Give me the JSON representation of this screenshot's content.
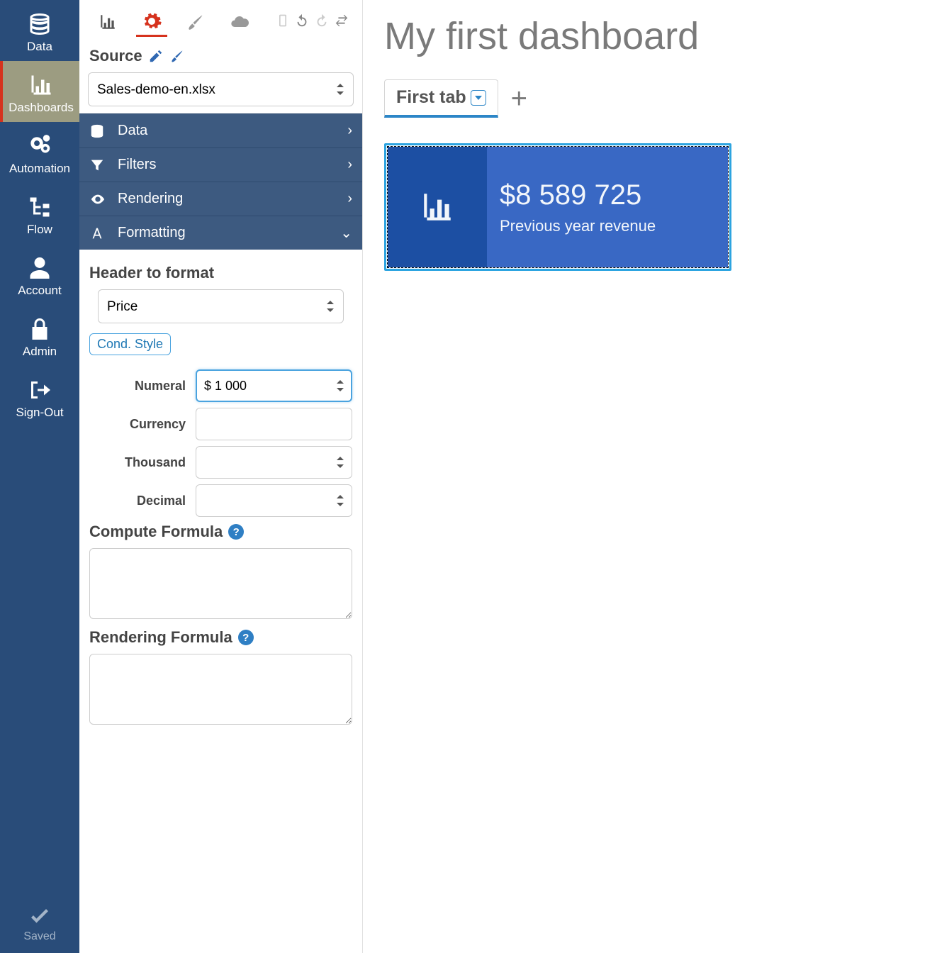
{
  "sidebar": {
    "items": [
      {
        "label": "Data"
      },
      {
        "label": "Dashboards"
      },
      {
        "label": "Automation"
      },
      {
        "label": "Flow"
      },
      {
        "label": "Account"
      },
      {
        "label": "Admin"
      },
      {
        "label": "Sign-Out"
      }
    ],
    "saved_label": "Saved"
  },
  "config": {
    "source_label": "Source",
    "source_value": "Sales-demo-en.xlsx",
    "accordion": {
      "data": "Data",
      "filters": "Filters",
      "rendering": "Rendering",
      "formatting": "Formatting"
    },
    "formatting": {
      "header_label": "Header to format",
      "header_value": "Price",
      "cond_style": "Cond. Style",
      "numeral_label": "Numeral",
      "numeral_value": "$ 1 000",
      "currency_label": "Currency",
      "currency_value": "",
      "thousand_label": "Thousand",
      "thousand_value": "",
      "decimal_label": "Decimal",
      "decimal_value": "",
      "compute_label": "Compute Formula",
      "rendering_label": "Rendering Formula"
    }
  },
  "main": {
    "dashboard_title": "My first dashboard",
    "tab_label": "First tab",
    "kpi_value": "$8 589 725",
    "kpi_label": "Previous year revenue"
  }
}
